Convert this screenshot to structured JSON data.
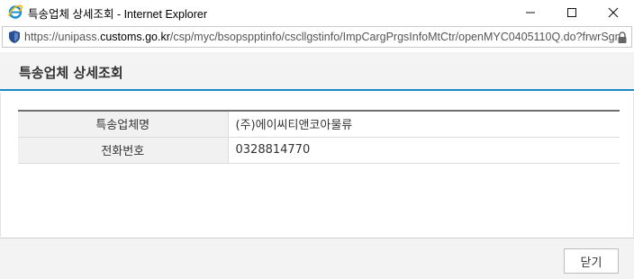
{
  "window": {
    "title": "특송업체 상세조회 - Internet Explorer"
  },
  "address": {
    "url_prefix": "https://unipass.",
    "url_domain": "customs.go.kr",
    "url_suffix": "/csp/myc/bsopspptinfo/cscllgstinfo/ImpCargPrgsInfoMtCtr/openMYC0405110Q.do?frwrSgn"
  },
  "page": {
    "title": "특송업체 상세조회"
  },
  "table": {
    "rows": [
      {
        "label": "특송업체명",
        "value": "(주)에이씨티앤코아물류"
      },
      {
        "label": "전화번호",
        "value": "0328814770"
      }
    ]
  },
  "footer": {
    "close_label": "닫기"
  },
  "colors": {
    "accent": "#1e88c9",
    "header_bg": "#f3f3f3"
  },
  "icons": [
    "ie-logo-icon",
    "minimize-icon",
    "maximize-icon",
    "close-icon",
    "security-shield-icon",
    "lock-icon"
  ]
}
